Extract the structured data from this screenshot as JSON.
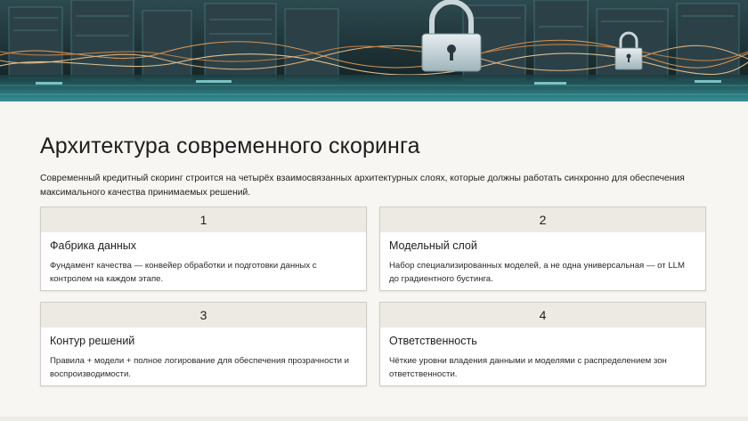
{
  "slide": {
    "title": "Архитектура современного скоринга",
    "intro": "Современный кредитный скоринг строится на четырёх взаимосвязанных архитектурных слоях, которые должны работать синхронно для обеспечения максимального качества принимаемых решений."
  },
  "cards": [
    {
      "number": "1",
      "title": "Фабрика данных",
      "text": "Фундамент качества — конвейер обработки и подготовки данных с контролем на каждом этапе."
    },
    {
      "number": "2",
      "title": "Модельный слой",
      "text": "Набор специализированных моделей, а не одна универсальная — от LLM до градиентного бустинга."
    },
    {
      "number": "3",
      "title": "Контур решений",
      "text": "Правила + модели + полное логирование для обеспечения прозрачности и воспроизводимости."
    },
    {
      "number": "4",
      "title": "Ответственность",
      "text": "Чёткие уровни владения данными и моделями с распределением зон ответственности."
    }
  ],
  "banner": {
    "subject": "padlock-over-data-center-image",
    "colors": {
      "teal": "#3fd1d6",
      "orange": "#f2a25a",
      "dark": "#1d2a30"
    }
  }
}
